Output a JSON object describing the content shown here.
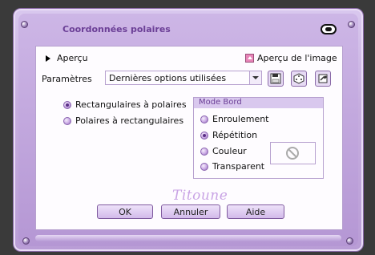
{
  "dialog": {
    "title": "Coordonnées polaires"
  },
  "preview": {
    "toggle_label": "Aperçu",
    "image_preview_label": "Aperçu de l'image"
  },
  "parameters": {
    "label": "Paramètres",
    "preset_value": "Dernières options utilisées"
  },
  "conversion": {
    "options": [
      {
        "label": "Rectangulaires à polaires",
        "checked": true
      },
      {
        "label": "Polaires à rectangulaires",
        "checked": false
      }
    ]
  },
  "edge_mode": {
    "title": "Mode Bord",
    "options": [
      {
        "label": "Enroulement",
        "checked": false
      },
      {
        "label": "Répétition",
        "checked": true
      },
      {
        "label": "Couleur",
        "checked": false
      },
      {
        "label": "Transparent",
        "checked": false
      }
    ]
  },
  "signature": "Titoune",
  "buttons": {
    "ok": "OK",
    "cancel": "Annuler",
    "help": "Aide"
  },
  "colors": {
    "accent": "#6b3f96",
    "frame": "#c6addf",
    "panel": "#fefcff"
  }
}
